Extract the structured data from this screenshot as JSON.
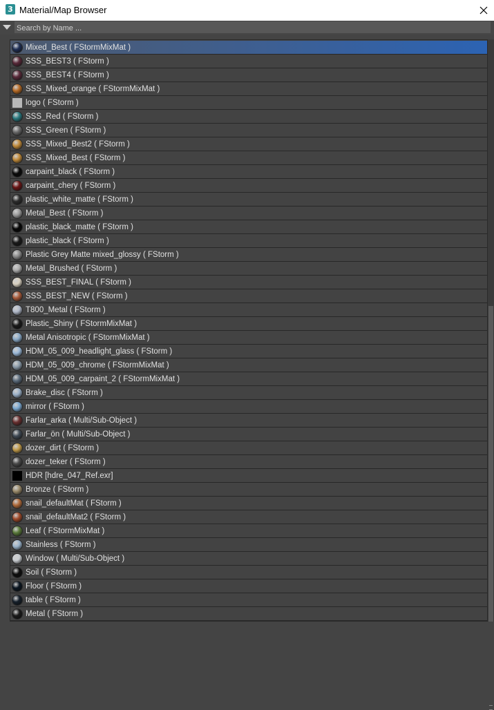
{
  "window": {
    "app_icon_glyph": "3",
    "title": "Material/Map Browser",
    "close_icon": "close-icon"
  },
  "search": {
    "placeholder": "Search by Name ..."
  },
  "colors": {
    "panel_bg": "#434343",
    "selection": "#2c63b3",
    "text": "#e0e0e0"
  },
  "materials": [
    {
      "name": "Mixed_Best ( FStormMixMat )",
      "swatch": "#1f2f55",
      "selected": true
    },
    {
      "name": "SSS_BEST3 ( FStorm )",
      "swatch": "#5a2a3a"
    },
    {
      "name": "SSS_BEST4 ( FStorm )",
      "swatch": "#5a2a3a"
    },
    {
      "name": "SSS_Mixed_orange ( FStormMixMat )",
      "swatch": "#b56a25"
    },
    {
      "name": "logo ( FStorm )",
      "swatch": "#b8b8b8",
      "square": true
    },
    {
      "name": "SSS_Red ( FStorm )",
      "swatch": "#2a7a80"
    },
    {
      "name": "SSS_Green ( FStorm )",
      "swatch": "#6a6a6a"
    },
    {
      "name": "SSS_Mixed_Best2 ( FStorm )",
      "swatch": "#c08a3a"
    },
    {
      "name": "SSS_Mixed_Best ( FStorm )",
      "swatch": "#c08a3a"
    },
    {
      "name": "carpaint_black ( FStorm )",
      "swatch": "#0a0a0a"
    },
    {
      "name": "carpaint_chery ( FStorm )",
      "swatch": "#6a1515"
    },
    {
      "name": "plastic_white_matte ( FStorm )",
      "swatch": "#2e2e2e"
    },
    {
      "name": "Metal_Best ( FStorm )",
      "swatch": "#9a9a9a"
    },
    {
      "name": "plastic_black_matte ( FStorm )",
      "swatch": "#050505"
    },
    {
      "name": "plastic_black ( FStorm )",
      "swatch": "#1a1a1a"
    },
    {
      "name": "Plastic Grey Matte mixed_glossy ( FStorm )",
      "swatch": "#8a8a8a"
    },
    {
      "name": "Metal_Brushed ( FStorm )",
      "swatch": "#aaaaaa"
    },
    {
      "name": "SSS_BEST_FINAL ( FStorm )",
      "swatch": "#d8d0c0"
    },
    {
      "name": "SSS_BEST_NEW ( FStorm )",
      "swatch": "#a85a3a"
    },
    {
      "name": "T800_Metal ( FStorm )",
      "swatch": "#b0b8c8"
    },
    {
      "name": "Plastic_Shiny ( FStormMixMat )",
      "swatch": "#1a1a1a"
    },
    {
      "name": "Metal Anisotropic ( FStormMixMat )",
      "swatch": "#8aaac8"
    },
    {
      "name": "HDM_05_009_headlight_glass ( FStorm )",
      "swatch": "#9ab8d8"
    },
    {
      "name": "HDM_05_009_chrome ( FStormMixMat )",
      "swatch": "#8a9aa8"
    },
    {
      "name": "HDM_05_009_carpaint_2 ( FStormMixMat )",
      "swatch": "#5a6a7a"
    },
    {
      "name": "Brake_disc ( FStorm )",
      "swatch": "#9ab0c8"
    },
    {
      "name": "mirror ( FStorm )",
      "swatch": "#7aa8d0"
    },
    {
      "name": "Farlar_arka ( Multi/Sub-Object )",
      "swatch": "#6a3030"
    },
    {
      "name": "Farlar_ön ( Multi/Sub-Object )",
      "swatch": "#404a55"
    },
    {
      "name": "dozer_dirt ( FStorm )",
      "swatch": "#c09a4a"
    },
    {
      "name": "dozer_teker ( FStorm )",
      "swatch": "#4a4a4a"
    },
    {
      "name": "HDR [hdre_047_Ref.exr]",
      "swatch": "#000000",
      "square": true
    },
    {
      "name": "Bronze ( FStorm )",
      "swatch": "#9a8a6a"
    },
    {
      "name": "snail_defaultMat ( FStorm )",
      "swatch": "#b06a3a"
    },
    {
      "name": "snail_defaultMat2 ( FStorm )",
      "swatch": "#a04a2a"
    },
    {
      "name": "Leaf ( FStormMixMat )",
      "swatch": "#5a7a3a"
    },
    {
      "name": "Stainless ( FStorm )",
      "swatch": "#9ab4cc"
    },
    {
      "name": "Window ( Multi/Sub-Object )",
      "swatch": "#c8ccd0"
    },
    {
      "name": "Soil ( FStorm )",
      "swatch": "#0e0e0e"
    },
    {
      "name": "Floor ( FStorm )",
      "swatch": "#0a1520"
    },
    {
      "name": "table ( FStorm )",
      "swatch": "#151f2a"
    },
    {
      "name": "Metal ( FStorm )",
      "swatch": "#1a1a1a"
    }
  ]
}
